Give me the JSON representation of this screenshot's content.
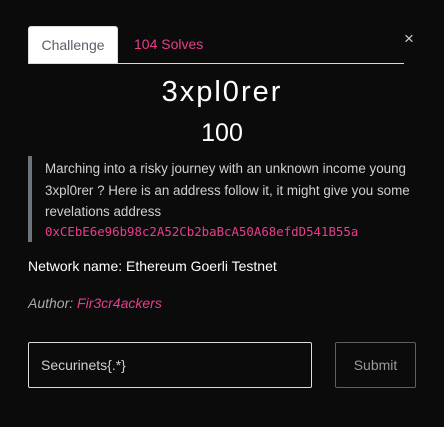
{
  "modal": {
    "close_glyph": "×",
    "tabs": [
      {
        "label": "Challenge"
      },
      {
        "label": "104 Solves"
      }
    ],
    "title": "3xpl0rer",
    "points": "100",
    "description": {
      "text": "Marching into a risky journey with an unknown income young 3xpl0rer ? Here is an address follow it, it might give you some revelations address",
      "address": "0xCEbE6e96b98c2A52Cb2baBcA50A68efdD541B55a"
    },
    "network": "Network name: Ethereum Goerli Testnet",
    "author": {
      "label": "Author: ",
      "name": "Fir3cr4ackers"
    },
    "flag_input": {
      "placeholder": "Securinets{.*}",
      "value": ""
    },
    "submit_label": "Submit"
  },
  "colors": {
    "background": "#0b0b0b",
    "accent": "#e83e8c",
    "blockquote_border": "#6c757d"
  }
}
